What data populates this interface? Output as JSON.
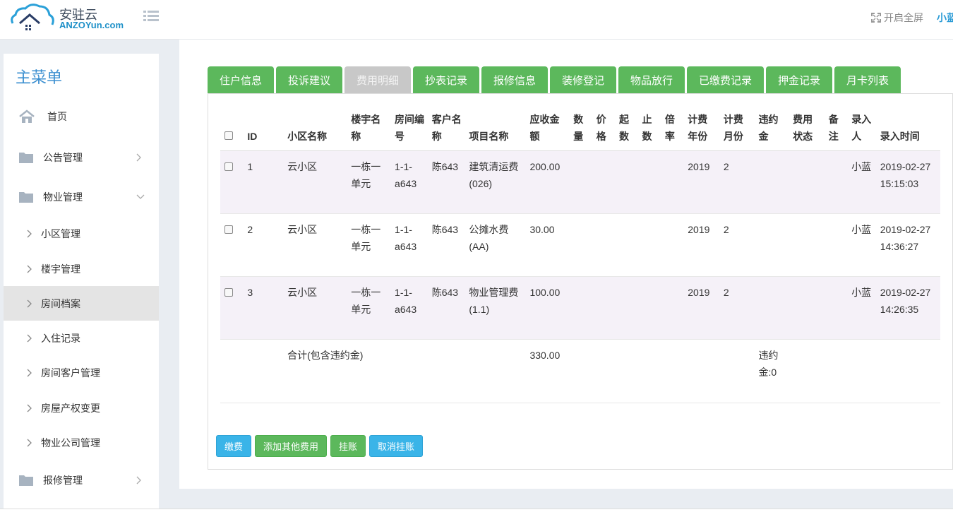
{
  "brand": {
    "name_cn": "安驻云",
    "name_en": "ANZOYun.com"
  },
  "header": {
    "fullscreen_label": "开启全屏",
    "username": "小蓝"
  },
  "sidebar": {
    "title": "主菜单",
    "items": [
      {
        "label": "首页"
      },
      {
        "label": "公告管理"
      },
      {
        "label": "物业管理"
      },
      {
        "label": "报修管理"
      }
    ],
    "subitems": [
      {
        "label": "小区管理"
      },
      {
        "label": "楼宇管理"
      },
      {
        "label": "房间档案"
      },
      {
        "label": "入住记录"
      },
      {
        "label": "房间客户管理"
      },
      {
        "label": "房屋产权变更"
      },
      {
        "label": "物业公司管理"
      }
    ]
  },
  "tabs": [
    "住户信息",
    "投诉建议",
    "费用明细",
    "抄表记录",
    "报修信息",
    "装修登记",
    "物品放行",
    "已缴费记录",
    "押金记录",
    "月卡列表"
  ],
  "table": {
    "columns": [
      "ID",
      "小区名称",
      "楼宇名称",
      "房间编号",
      "客户名称",
      "项目名称",
      "应收金额",
      "数量",
      "价格",
      "起数",
      "止数",
      "倍率",
      "计费年份",
      "计费月份",
      "违约金",
      "费用状态",
      "备注",
      "录入人",
      "录入时间"
    ],
    "rows": [
      {
        "id": "1",
        "community": "云小区",
        "building": "一栋一单元",
        "room": "1-1-a643",
        "customer": "陈643",
        "item": "建筑清运费(026)",
        "amount": "200.00",
        "qty": "",
        "price": "",
        "start": "",
        "end": "",
        "rate": "",
        "year": "2019",
        "month": "2",
        "penalty": "",
        "status": "",
        "note": "",
        "operator": "小蓝",
        "time": "2019-02-27 15:15:03"
      },
      {
        "id": "2",
        "community": "云小区",
        "building": "一栋一单元",
        "room": "1-1-a643",
        "customer": "陈643",
        "item": "公摊水费(AA)",
        "amount": "30.00",
        "qty": "",
        "price": "",
        "start": "",
        "end": "",
        "rate": "",
        "year": "2019",
        "month": "2",
        "penalty": "",
        "status": "",
        "note": "",
        "operator": "小蓝",
        "time": "2019-02-27 14:36:27"
      },
      {
        "id": "3",
        "community": "云小区",
        "building": "一栋一单元",
        "room": "1-1-a643",
        "customer": "陈643",
        "item": "物业管理费(1.1)",
        "amount": "100.00",
        "qty": "",
        "price": "",
        "start": "",
        "end": "",
        "rate": "",
        "year": "2019",
        "month": "2",
        "penalty": "",
        "status": "",
        "note": "",
        "operator": "小蓝",
        "time": "2019-02-27 14:26:35"
      }
    ],
    "total": {
      "label": "合计(包含违约金)",
      "amount": "330.00",
      "penalty": "违约金:0"
    }
  },
  "buttons": {
    "pay": "缴费",
    "add_fee": "添加其他费用",
    "hang": "挂账",
    "cancel_hang": "取消挂账"
  },
  "colors": {
    "green": "#5cb85c",
    "blue": "#3ab4e8",
    "accent": "#3b8fd0"
  }
}
